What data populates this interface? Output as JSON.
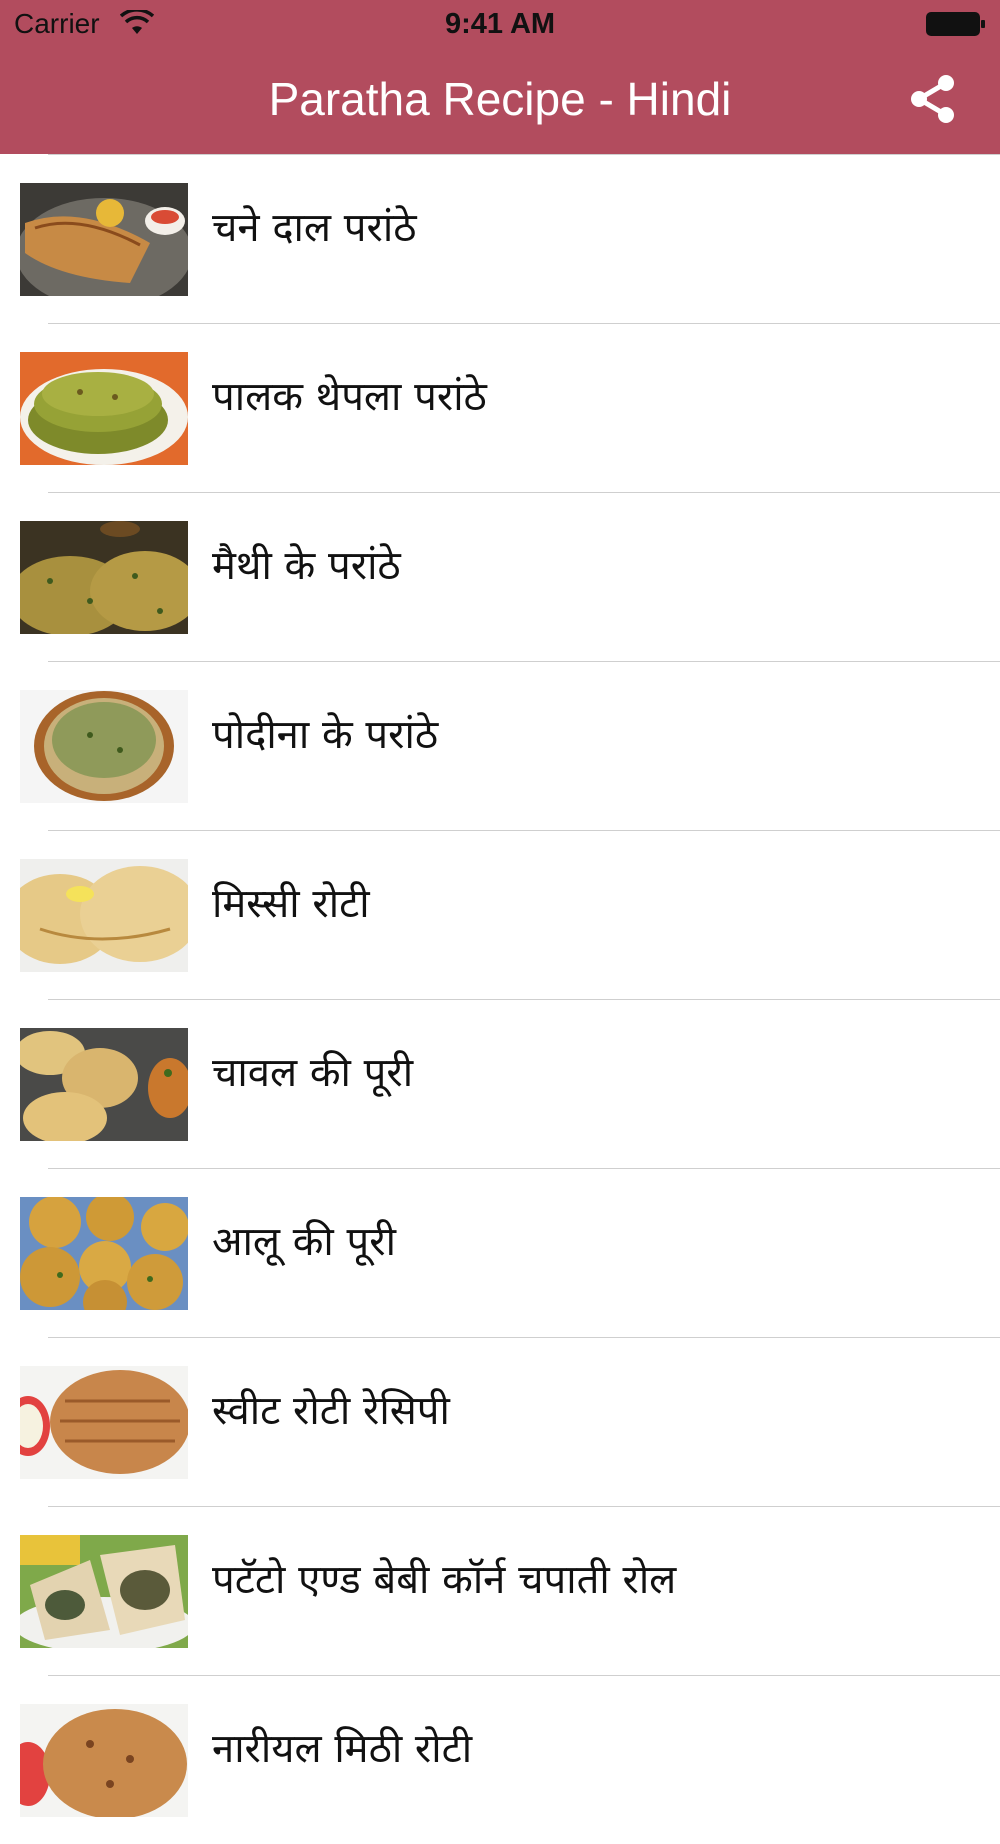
{
  "status_bar": {
    "carrier": "Carrier",
    "time": "9:41 AM"
  },
  "nav": {
    "title": "Paratha Recipe - Hindi",
    "share_icon": "share-icon"
  },
  "colors": {
    "brand": "#b24c5e"
  },
  "recipes": [
    {
      "label": "चने  दाल  परांठे"
    },
    {
      "label": "पालक थेपला परांठे"
    },
    {
      "label": "मैथी के परांठे"
    },
    {
      "label": "पोदीना के परांठे"
    },
    {
      "label": "मिस्सी रोटी"
    },
    {
      "label": "चावल की पूरी"
    },
    {
      "label": "आलू की पूरी"
    },
    {
      "label": "स्वीट रोटी रेसिपी"
    },
    {
      "label": "पटॅटो एण्ड बेबी कॉर्न चपाती रोल"
    },
    {
      "label": "नारीयल मिठी रोटी"
    }
  ]
}
